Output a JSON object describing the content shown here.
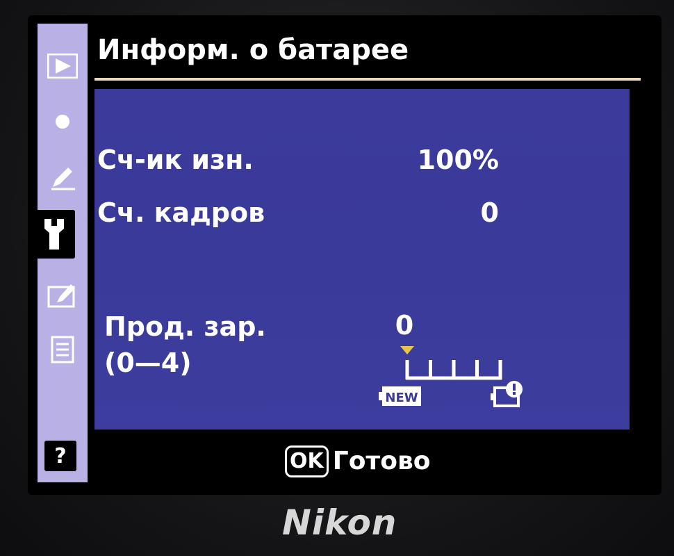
{
  "header": {
    "title": "Информ. о батарее"
  },
  "sidebar": {
    "tabs": [
      {
        "name": "playback-menu",
        "icon": "play-icon",
        "active": false
      },
      {
        "name": "shooting-menu",
        "icon": "camera-dot-icon",
        "active": false
      },
      {
        "name": "custom-settings",
        "icon": "pencil-icon",
        "active": false
      },
      {
        "name": "setup-menu",
        "icon": "wrench-icon",
        "active": true
      },
      {
        "name": "retouch-menu",
        "icon": "retouch-icon",
        "active": false
      },
      {
        "name": "my-menu",
        "icon": "list-icon",
        "active": false
      }
    ],
    "help_label": "?"
  },
  "battery_info": {
    "wear_counter": {
      "label": "Сч-ик изн.",
      "value": "100%"
    },
    "shot_counter": {
      "label": "Сч. кадров",
      "value": "0"
    },
    "charge_life": {
      "label_line1": "Прод. зар.",
      "label_line2": "(0—4)",
      "value": "0",
      "level": 0,
      "scale_max": 4,
      "new_label": "NEW",
      "end_icon": "battery-warning-icon"
    }
  },
  "footer": {
    "ok_label": "OK",
    "action_label": "Готово"
  },
  "brand": "Nikon",
  "colors": {
    "panel": "#3c3b9c",
    "sidebar": "#b9b0e6",
    "marker": "#e8c64a",
    "rule": "#e9d9b8"
  }
}
